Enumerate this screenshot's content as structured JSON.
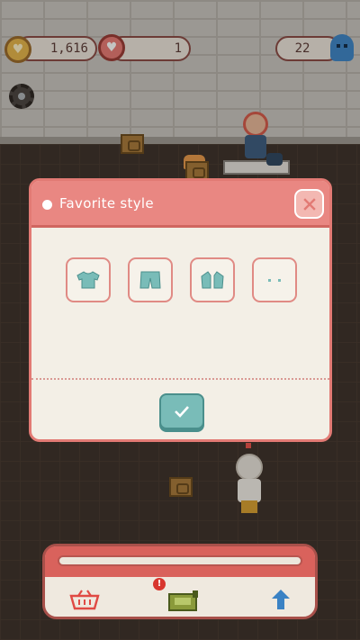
{
  "hud": {
    "coins": "1,616",
    "hearts": "1",
    "visitors": "22"
  },
  "dialog": {
    "title": "Favorite style",
    "options": [
      {
        "icon": "tshirt-icon"
      },
      {
        "icon": "shorts-icon"
      },
      {
        "icon": "jacket-icon"
      },
      {
        "icon": "earrings-icon"
      }
    ],
    "confirm_icon": "checkmark-icon",
    "close_icon": "close-icon"
  },
  "bottom_bar": {
    "buttons": [
      {
        "icon": "basket-icon"
      },
      {
        "icon": "cash-register-icon"
      },
      {
        "icon": "upgrade-arrow-icon"
      }
    ],
    "alert": "!"
  },
  "colors": {
    "header": "#e98782",
    "dialog_bg": "#f3efe6",
    "accent_teal": "#79bcb8",
    "border_red": "#e27a74"
  }
}
